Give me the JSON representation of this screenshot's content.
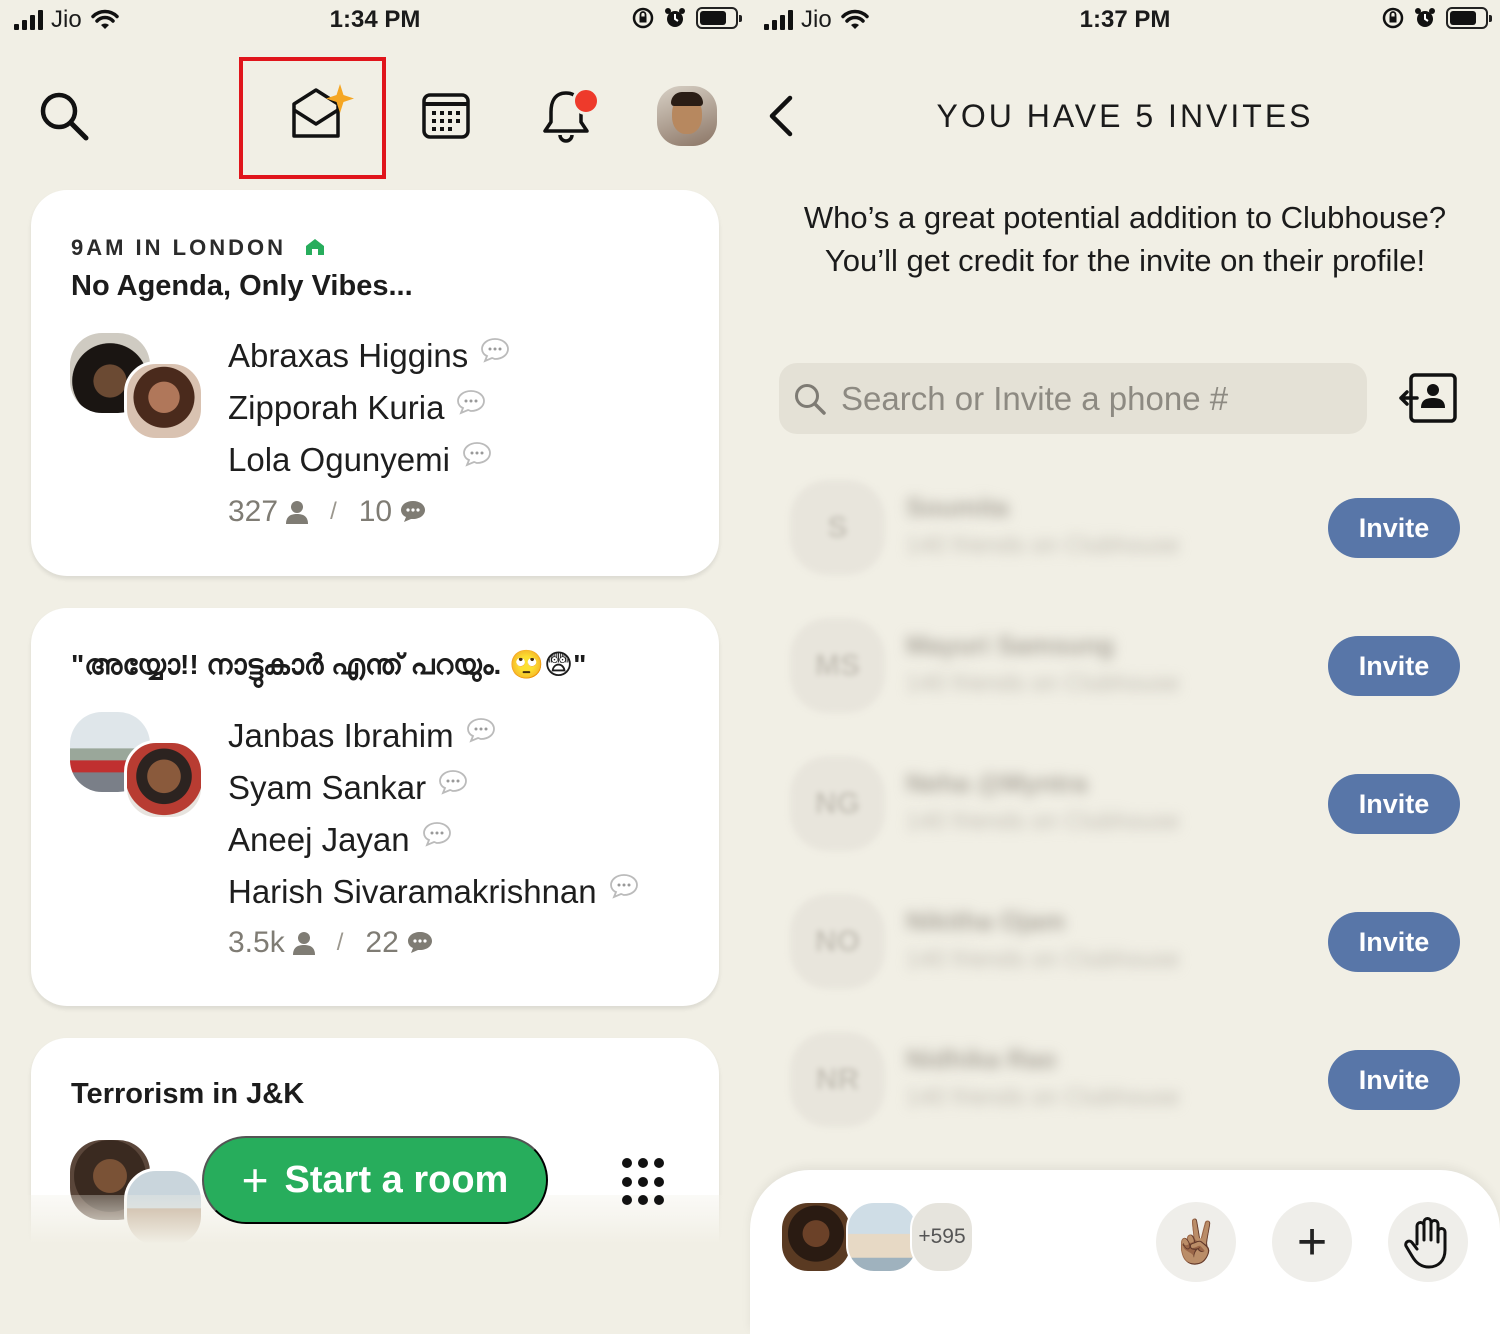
{
  "left": {
    "status": {
      "carrier": "Jio",
      "time": "1:34 PM"
    },
    "rooms": [
      {
        "club": "9AM IN LONDON",
        "title": "No Agenda, Only Vibes...",
        "speakers": [
          "Abraxas Higgins",
          "Zipporah Kuria",
          "Lola Ogunyemi"
        ],
        "listeners": "327",
        "speaking": "10"
      },
      {
        "title": "\"അയ്യോ!! നാട്ടുകാർ എന്ത് പറയും. 🙄😨\"",
        "speakers": [
          "Janbas Ibrahim",
          "Syam Sankar",
          "Aneej Jayan",
          "Harish Sivaramakrishnan"
        ],
        "listeners": "3.5k",
        "speaking": "22"
      },
      {
        "title": "Terrorism in J&K"
      }
    ],
    "start_room": {
      "plus": "+",
      "label": "Start a room"
    }
  },
  "right": {
    "status": {
      "carrier": "Jio",
      "time": "1:37 PM"
    },
    "title": "YOU HAVE 5 INVITES",
    "subtitle_line1": "Who’s a great potential addition to Clubhouse?",
    "subtitle_line2": "You’ll get credit for the invite on their profile!",
    "search_placeholder": "Search or Invite a phone #",
    "contacts": [
      {
        "initials": "S",
        "name": "Soumita",
        "sub": "140 friends on Clubhouse",
        "button": "Invite"
      },
      {
        "initials": "MS",
        "name": "Mayuri Samsung",
        "sub": "140 friends on Clubhouse",
        "button": "Invite"
      },
      {
        "initials": "NG",
        "name": "Neha @Myntra",
        "sub": "140 friends on Clubhouse",
        "button": "Invite"
      },
      {
        "initials": "NO",
        "name": "Nikitha Ojam",
        "sub": "140 friends on Clubhouse",
        "button": "Invite"
      },
      {
        "initials": "NR",
        "name": "Nidhika Rao",
        "sub": "140 friends on Clubhouse",
        "button": "Invite"
      }
    ],
    "bottom": {
      "more_count": "+595",
      "peace": "✌🏽",
      "plus": "+",
      "hand": "✋"
    }
  },
  "colors": {
    "accent_green": "#27ad5c",
    "invite_blue": "#5876a8",
    "background": "#f1efe5",
    "highlight_red": "#e0141b",
    "notification_red": "#ee3a2b"
  },
  "icons": [
    "search-icon",
    "invite-envelope-icon",
    "calendar-icon",
    "bell-icon",
    "back-chevron-icon",
    "contacts-icon",
    "chat-bubble-icon",
    "person-icon",
    "grid-icon",
    "raise-hand-icon"
  ]
}
